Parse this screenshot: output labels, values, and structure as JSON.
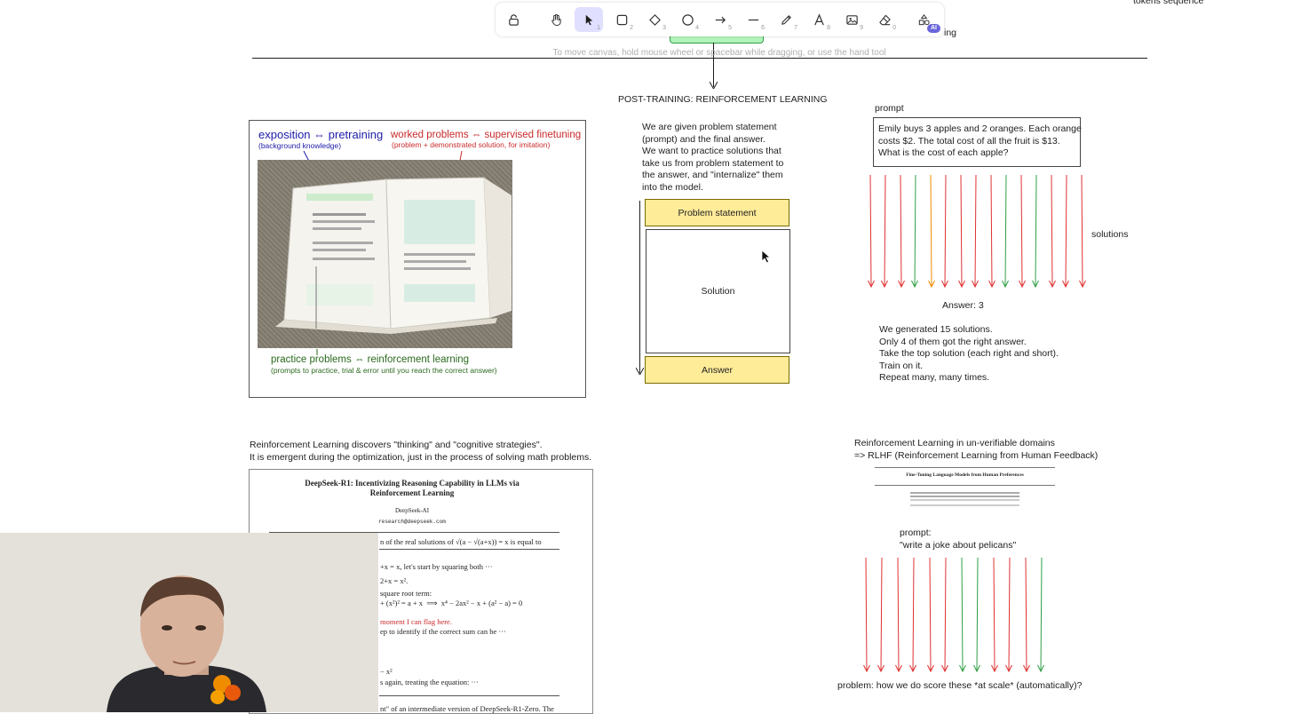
{
  "toolbar": {
    "tools": [
      {
        "name": "lock",
        "kbd": ""
      },
      {
        "name": "hand",
        "kbd": ""
      },
      {
        "name": "selection",
        "kbd": "1"
      },
      {
        "name": "rectangle",
        "kbd": "2"
      },
      {
        "name": "diamond",
        "kbd": "3"
      },
      {
        "name": "ellipse",
        "kbd": "4"
      },
      {
        "name": "arrow",
        "kbd": "5"
      },
      {
        "name": "line",
        "kbd": "6"
      },
      {
        "name": "draw",
        "kbd": "7"
      },
      {
        "name": "text",
        "kbd": "8"
      },
      {
        "name": "image",
        "kbd": "9"
      },
      {
        "name": "eraser",
        "kbd": "0"
      }
    ],
    "ai_badge": "AI"
  },
  "canvas_hint": "To move canvas, hold mouse wheel or spacebar while dragging, or use the hand tool",
  "top_fragments": {
    "right_top": "tokens sequence",
    "right_mid": "ing"
  },
  "section_title": "POST-TRAINING: REINFORCEMENT LEARNING",
  "textbook": {
    "exposition": "exposition ⇔ pretraining",
    "exposition_sub": "(background knowledge)",
    "worked": "worked problems ⇔ supervised finetuning",
    "worked_sub": "(problem + demonstrated solution, for imitation)",
    "practice": "practice problems ⇔ reinforcement learning",
    "practice_sub": "(prompts to practice, trial & error until you reach the correct answer)"
  },
  "explain": "We are given problem statement\n(prompt) and the final answer.\nWe want to practice solutions that\ntake us from problem statement to\nthe answer, and \"internalize\" them\ninto the model.",
  "flow": {
    "problem": "Problem statement",
    "solution": "Solution",
    "answer": "Answer"
  },
  "prompt_label": "prompt",
  "prompt_text": "Emily buys 3 apples and 2 oranges. Each orange\ncosts $2. The total cost of all the fruit is $13.\nWhat is the cost of each apple?",
  "solutions_label": "solutions",
  "answer_label": "Answer: 3",
  "summary": "We generated 15 solutions.\nOnly 4 of them got the right answer.\nTake the top solution (each right and short).\nTrain on it.\nRepeat many, many times.",
  "rl_note": "Reinforcement Learning discovers \"thinking\" and \"cognitive strategies\".\nIt is emergent during the optimization, just in the process of solving math problems.",
  "paper": {
    "title": "DeepSeek-R1: Incentivizing Reasoning Capability in LLMs via\nReinforcement Learning",
    "author": "DeepSeek-AI",
    "email": "research@deepseek.com",
    "lines": [
      "n of the real solutions of √(a − √(a+x)) = x is equal to",
      "+x = x, let's start by squaring both ···",
      "2+x = x².",
      "square root term:",
      "+ (x²)² = a + x  ⟹  x⁴ − 2ax² − x + (a² − a) = 0",
      "moment I can flag here.",
      "ep to identify if the correct sum can be ···",
      "− x²",
      "s again, treating the equation: ···",
      "nt\" of an intermediate version of DeepSeek-R1-Zero. The"
    ]
  },
  "rlhf_note": "Reinforcement Learning in un-verifiable domains\n=> RLHF (Reinforcement Learning from Human Feedback)",
  "rlhf_paper_title": "Fine-Tuning Language Models from Human Preferences",
  "rlhf_prompt": "prompt:\n\"write a joke about pelicans\"",
  "rlhf_problem": "problem: how we do score these *at scale* (automatically)?",
  "colors": {
    "accent": "#6965db",
    "yellow": "#ffec99",
    "red": "#e03131",
    "green": "#2f9e44",
    "orange": "#f08c00",
    "blue": "#1c1ca8",
    "dark_red": "#c92a2a",
    "dark_green": "#2b6a1f"
  },
  "solution_arrows": [
    "red",
    "red",
    "red",
    "green",
    "orange",
    "red",
    "red",
    "red",
    "red",
    "green",
    "red",
    "green",
    "red",
    "red",
    "red"
  ],
  "rlhf_arrows": [
    "red",
    "red",
    "red",
    "red",
    "red",
    "red",
    "green",
    "green",
    "red",
    "red",
    "red",
    "green"
  ]
}
